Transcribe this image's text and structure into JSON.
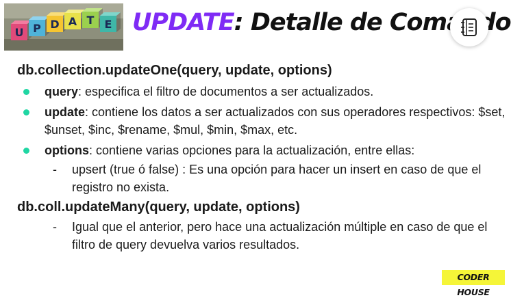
{
  "header": {
    "title_accent": "UPDATE",
    "title_rest": ": Detalle de Comando",
    "thumbnail_letters": [
      "U",
      "P",
      "D",
      "A",
      "T",
      "E"
    ],
    "notebook_icon": "notebook-icon"
  },
  "section1": {
    "heading": "db.collection.updateOne(query, update, options)",
    "bullets": [
      {
        "term": "query",
        "text": ": especifica el filtro de documentos a ser actualizados."
      },
      {
        "term": "update",
        "text": ": contiene los datos a ser actualizados con sus operadores respectivos: $set, $unset, $inc, $rename, $mul, $min, $max, etc."
      },
      {
        "term": "options",
        "text": ": contiene varias opciones para la actualización, entre ellas:"
      }
    ],
    "sub": "upsert (true ó false) : Es una opción para hacer un insert en caso de que el registro no exista."
  },
  "section2": {
    "heading": "db.coll.updateMany(query, update, options)",
    "sub": "Igual que el anterior, pero hace una actualización múltiple en caso de que el filtro de query devuelva varios resultados."
  },
  "footer": {
    "logo": "CODER HOUSE"
  },
  "colors": {
    "accent": "#7f2bf5",
    "bullet": "#20d6a3",
    "logo_bg": "#f5f538"
  }
}
